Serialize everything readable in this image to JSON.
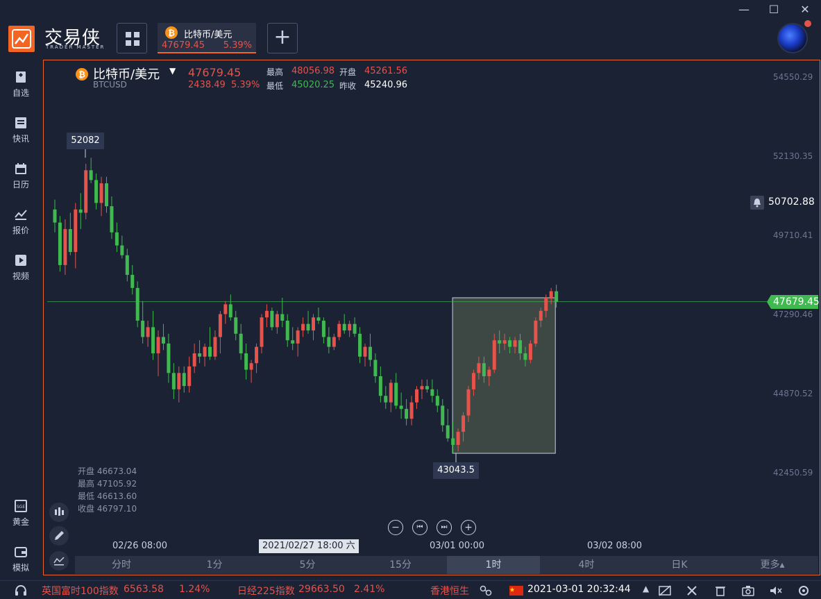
{
  "app": {
    "logo_name": "交易侠",
    "logo_sub": "TRADER MASTER",
    "window_controls": [
      "minimize-icon",
      "maximize-icon",
      "close-icon"
    ]
  },
  "tab": {
    "name": "比特币/美元",
    "price": "47679.45",
    "change_pct": "5.39%"
  },
  "sidebar": {
    "items": [
      {
        "label": "自选",
        "icon": "bookmark-icon"
      },
      {
        "label": "快讯",
        "icon": "news-icon"
      },
      {
        "label": "日历",
        "icon": "calendar-icon"
      },
      {
        "label": "报价",
        "icon": "quote-chart-icon"
      },
      {
        "label": "视频",
        "icon": "video-icon"
      },
      {
        "label": "黄金",
        "icon": "gold-icon"
      },
      {
        "label": "模拟",
        "icon": "wallet-icon"
      }
    ]
  },
  "header": {
    "name": "比特币/美元",
    "symbol": "BTCUSD",
    "price": "47679.45",
    "change": "2438.49",
    "change_pct": "5.39%",
    "high_label": "最高",
    "high": "48056.98",
    "low_label": "最低",
    "low": "45020.25",
    "open_label": "开盘",
    "open": "45261.56",
    "prev_label": "昨收",
    "prev_close": "45240.96"
  },
  "cursor_ohlc": {
    "open": "开盘 46673.04",
    "high": "最高 47105.92",
    "low": "最低 46613.60",
    "close": "收盘 46797.10"
  },
  "markers": {
    "max_label": "52082",
    "min_label": "43043.5",
    "current_price": "47679.45",
    "alert_price": "50702.88",
    "crosshair_time": "2021/02/27 18:00 六"
  },
  "colors": {
    "up": "#e5534b",
    "down": "#3fb950",
    "accent": "#f26522",
    "bg": "#1b2233"
  },
  "chart_data": {
    "type": "candlestick",
    "timeframe": "1时",
    "y_ticks": [
      "54550.29",
      "52130.35",
      "49710.41",
      "47290.46",
      "44870.52",
      "42450.59"
    ],
    "x_ticks": [
      "02/26 08:00",
      "03/01 00:00",
      "03/02 08:00"
    ],
    "ylim": [
      42450.59,
      54550.29
    ],
    "candles": [
      [
        50500,
        50800,
        49800,
        50100
      ],
      [
        50100,
        50300,
        48600,
        48800
      ],
      [
        48800,
        50200,
        48500,
        49900
      ],
      [
        49900,
        50400,
        49100,
        49200
      ],
      [
        49200,
        50700,
        48700,
        50500
      ],
      [
        50500,
        51000,
        49900,
        50400
      ],
      [
        50400,
        51900,
        50200,
        51700
      ],
      [
        51700,
        52082,
        51300,
        51400
      ],
      [
        51400,
        51600,
        50500,
        50700
      ],
      [
        50700,
        51500,
        50300,
        51300
      ],
      [
        51300,
        51500,
        50400,
        50600
      ],
      [
        50600,
        50900,
        49600,
        49800
      ],
      [
        49800,
        50100,
        49200,
        49400
      ],
      [
        49400,
        49700,
        49000,
        49100
      ],
      [
        49100,
        49300,
        48300,
        48500
      ],
      [
        48500,
        48800,
        47900,
        48100
      ],
      [
        48100,
        48300,
        46900,
        47100
      ],
      [
        47100,
        47700,
        46400,
        46600
      ],
      [
        46600,
        47100,
        46300,
        46900
      ],
      [
        46900,
        47400,
        45900,
        46100
      ],
      [
        46100,
        46800,
        45400,
        46600
      ],
      [
        46600,
        47000,
        46200,
        46400
      ],
      [
        46400,
        46700,
        45200,
        45500
      ],
      [
        45500,
        45800,
        44700,
        45000
      ],
      [
        45000,
        45700,
        44600,
        45500
      ],
      [
        45500,
        45700,
        44900,
        45100
      ],
      [
        45100,
        46000,
        44900,
        45700
      ],
      [
        45700,
        46400,
        45500,
        46100
      ],
      [
        46100,
        46500,
        45800,
        46000
      ],
      [
        46000,
        46400,
        45700,
        46300
      ],
      [
        46300,
        46900,
        45900,
        46000
      ],
      [
        46000,
        46800,
        45900,
        46600
      ],
      [
        46600,
        47400,
        46100,
        47300
      ],
      [
        47300,
        47700,
        47000,
        47600
      ],
      [
        47600,
        47900,
        47100,
        47200
      ],
      [
        47200,
        47400,
        46500,
        46700
      ],
      [
        46700,
        47000,
        45900,
        46100
      ],
      [
        46100,
        46400,
        45300,
        45600
      ],
      [
        45600,
        45900,
        45200,
        45800
      ],
      [
        45800,
        46400,
        45500,
        46300
      ],
      [
        46300,
        47300,
        46100,
        47200
      ],
      [
        47200,
        47600,
        46900,
        47400
      ],
      [
        47400,
        47500,
        46800,
        46900
      ],
      [
        46900,
        47400,
        46700,
        47300
      ],
      [
        47300,
        47800,
        46900,
        47100
      ],
      [
        47100,
        47300,
        46300,
        46500
      ],
      [
        46500,
        46900,
        46200,
        46400
      ],
      [
        46400,
        46900,
        46000,
        46800
      ],
      [
        46800,
        47200,
        46600,
        47000
      ],
      [
        47000,
        47400,
        46700,
        46800
      ],
      [
        46800,
        47300,
        46500,
        47200
      ],
      [
        47200,
        47500,
        47000,
        47100
      ],
      [
        47100,
        47200,
        46400,
        46600
      ],
      [
        46600,
        46900,
        46100,
        46300
      ],
      [
        46300,
        46700,
        46200,
        46600
      ],
      [
        46600,
        47100,
        46500,
        47000
      ],
      [
        47000,
        47300,
        46700,
        46800
      ],
      [
        46800,
        47100,
        46600,
        47000
      ],
      [
        47000,
        47200,
        46600,
        46700
      ],
      [
        46700,
        46900,
        45800,
        46000
      ],
      [
        46000,
        46400,
        45700,
        46300
      ],
      [
        46300,
        46700,
        45700,
        45900
      ],
      [
        45900,
        46100,
        45200,
        45400
      ],
      [
        45400,
        45700,
        44600,
        44800
      ],
      [
        44800,
        45100,
        44400,
        44600
      ],
      [
        44600,
        45300,
        44300,
        45200
      ],
      [
        45200,
        45500,
        44400,
        44500
      ],
      [
        44500,
        44900,
        44100,
        44400
      ],
      [
        44400,
        44700,
        43900,
        44100
      ],
      [
        44100,
        44800,
        43900,
        44600
      ],
      [
        44600,
        45100,
        44400,
        45000
      ],
      [
        45000,
        45300,
        44700,
        45100
      ],
      [
        45100,
        45300,
        44900,
        45000
      ],
      [
        45000,
        45300,
        44600,
        44800
      ],
      [
        44800,
        45000,
        44300,
        44500
      ],
      [
        44500,
        44700,
        43700,
        43900
      ],
      [
        43900,
        44400,
        43400,
        43500
      ],
      [
        43500,
        44000,
        43043.5,
        43300
      ],
      [
        43300,
        43800,
        43100,
        43700
      ],
      [
        43700,
        44300,
        43400,
        44200
      ],
      [
        44200,
        45100,
        44000,
        45000
      ],
      [
        45000,
        45600,
        44800,
        45500
      ],
      [
        45500,
        46000,
        45300,
        45800
      ],
      [
        45800,
        46000,
        45200,
        45400
      ],
      [
        45400,
        45700,
        45100,
        45600
      ],
      [
        45600,
        46700,
        45500,
        46500
      ],
      [
        46500,
        46800,
        46100,
        46400
      ],
      [
        46400,
        46700,
        46200,
        46500
      ],
      [
        46500,
        46600,
        46100,
        46300
      ],
      [
        46300,
        46600,
        46100,
        46500
      ],
      [
        46500,
        46700,
        45900,
        46100
      ],
      [
        46100,
        46300,
        45700,
        45900
      ],
      [
        45900,
        46500,
        45800,
        46400
      ],
      [
        46400,
        47200,
        46300,
        47100
      ],
      [
        47100,
        47500,
        46900,
        47400
      ],
      [
        47400,
        47900,
        47200,
        47800
      ],
      [
        47800,
        48100,
        47600,
        48000
      ],
      [
        48000,
        48200,
        47500,
        47679.45
      ]
    ]
  },
  "timeframes": {
    "items": [
      "分时",
      "1分",
      "5分",
      "15分",
      "1时",
      "4时",
      "日K",
      "更多▴"
    ],
    "active": "1时"
  },
  "ticker": {
    "items": [
      {
        "name": "英国富时100指数",
        "value": "6563.58",
        "pct": "1.24%"
      },
      {
        "name": "日经225指数",
        "value": "29663.50",
        "pct": "2.41%"
      },
      {
        "name": "香港恒生",
        "value": "",
        "pct": ""
      }
    ],
    "datetime": "2021-03-01 20:32:44"
  }
}
